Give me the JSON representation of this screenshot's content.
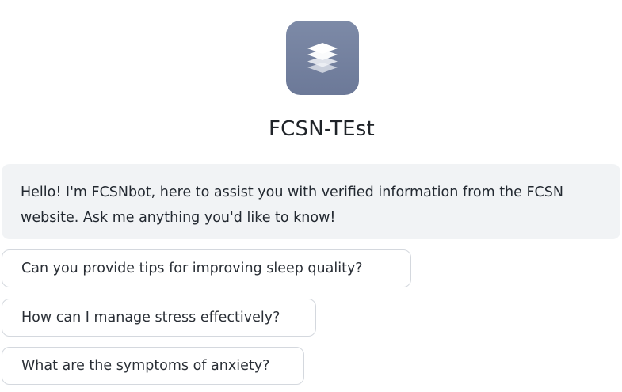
{
  "app": {
    "title": "FCSN-TEst",
    "icon": "layers-icon",
    "icon_color": "#7584a1"
  },
  "chat": {
    "greeting": "Hello! I'm FCSNbot, here to assist you with verified information from the FCSN website. Ask me anything you'd like to know!"
  },
  "suggestions": [
    {
      "label": "Can you provide tips for improving sleep quality?"
    },
    {
      "label": "How can I manage stress effectively?"
    },
    {
      "label": "What are the symptoms of anxiety?"
    }
  ]
}
